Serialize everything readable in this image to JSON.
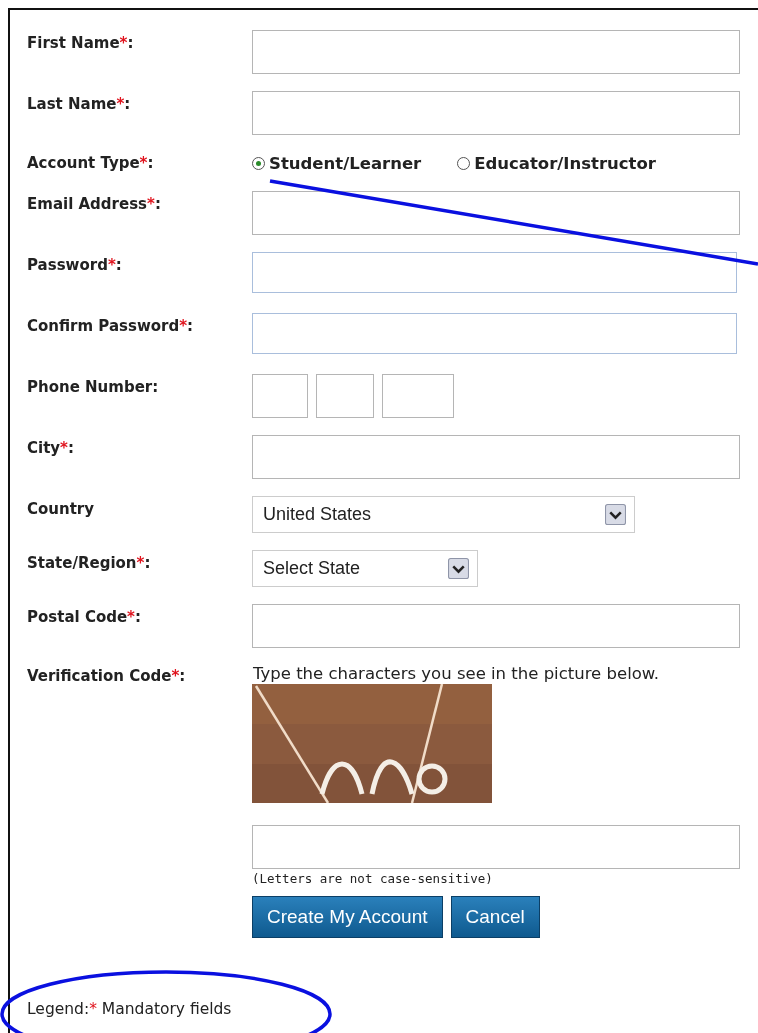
{
  "form": {
    "fields": [
      {
        "kind": "text",
        "name": "First Name",
        "mark": "*",
        "colon": ":"
      },
      {
        "kind": "text",
        "name": "Last Name",
        "mark": "*",
        "colon": ":"
      },
      {
        "kind": "radio",
        "name": "Account Type",
        "mark": "*",
        "colon": ":",
        "options": [
          {
            "label": "Student/Learner",
            "selected": true
          },
          {
            "label": "Educator/Instructor",
            "selected": false
          }
        ]
      },
      {
        "kind": "text",
        "name": "Email Address",
        "mark": "*",
        "colon": ":"
      },
      {
        "kind": "password",
        "name": "Password",
        "mark": "*",
        "colon": ":"
      },
      {
        "kind": "password",
        "name": "Confirm Password",
        "mark": "*",
        "colon": ":"
      },
      {
        "kind": "phone",
        "name": "Phone Number:"
      },
      {
        "kind": "text",
        "name": "City",
        "mark": "*",
        "colon": ":"
      },
      {
        "kind": "select",
        "name": "Country",
        "value": "United States",
        "wide": true
      },
      {
        "kind": "select",
        "name": "State/Region",
        "mark": "*",
        "colon": ":",
        "value": "Select State",
        "wide": false
      },
      {
        "kind": "text",
        "name": "Postal Code",
        "mark": "*",
        "colon": ":"
      },
      {
        "kind": "captcha",
        "name": "Verification Code",
        "mark": "*",
        "colon": ":",
        "instruction": "Type the characters you see in the picture below.",
        "hint": "(Letters are not case-sensitive)"
      }
    ],
    "buttons": [
      {
        "label": "Create My Account"
      },
      {
        "label": "Cancel"
      }
    ],
    "legend": {
      "label": "Legend:",
      "mark": "*",
      "text": "Mandatory fields"
    }
  }
}
